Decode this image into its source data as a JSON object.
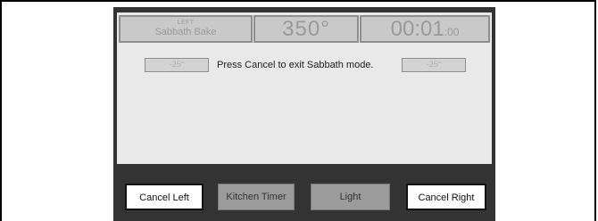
{
  "oven": {
    "position": "LEFT",
    "mode": "Sabbath Bake",
    "temperature": "350°",
    "timer_main": "00:01",
    "timer_seconds": ":00"
  },
  "adjust": {
    "left_label": "-25°",
    "right_label": "-25°"
  },
  "message": "Press Cancel to exit Sabbath mode.",
  "buttons": {
    "cancel_left": "Cancel Left",
    "kitchen_timer": "Kitchen Timer",
    "light": "Light",
    "cancel_right": "Cancel Right"
  }
}
